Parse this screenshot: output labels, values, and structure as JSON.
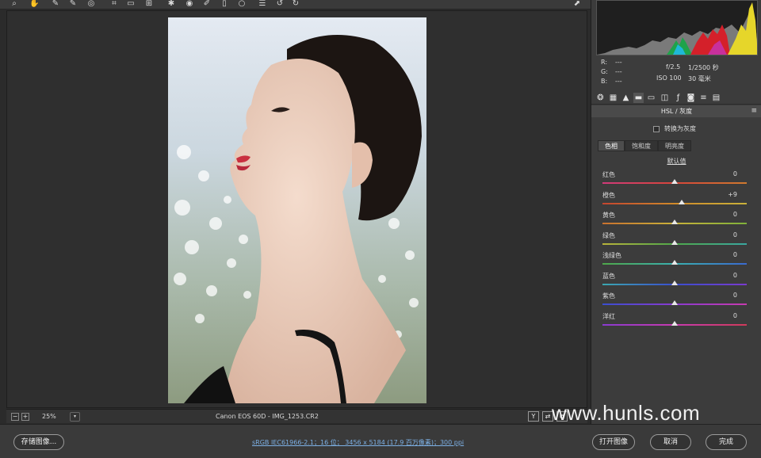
{
  "toolbar": {
    "tools": [
      "zoom-icon",
      "hand-icon",
      "white-balance-icon",
      "color-sampler-icon",
      "target-adjust-icon",
      "crop-icon",
      "straighten-icon",
      "transform-icon",
      "spot-removal-icon",
      "red-eye-icon",
      "adjustment-brush-icon",
      "graduated-filter-icon",
      "radial-filter-icon",
      "preferences-icon",
      "rotate-left-icon",
      "rotate-right-icon"
    ],
    "right_icon": "fullscreen-icon"
  },
  "readout": {
    "r_label": "R:",
    "r_value": "---",
    "g_label": "G:",
    "g_value": "---",
    "b_label": "B:",
    "b_value": "---",
    "aperture": "f/2.5",
    "shutter": "1/2500 秒",
    "iso": "ISO 100",
    "focal": "30 毫米"
  },
  "panel": {
    "section_title": "HSL / 灰度",
    "convert_gray": "转换为灰度",
    "subtabs": [
      {
        "label": "色相",
        "active": true
      },
      {
        "label": "饱和度",
        "active": false
      },
      {
        "label": "明亮度",
        "active": false
      }
    ],
    "defaults_link": "默认值",
    "sliders": [
      {
        "label": "红色",
        "value": "0",
        "pos": 0.5,
        "gradient": [
          "#d13a7a",
          "#d8463a",
          "#d07a2e"
        ]
      },
      {
        "label": "橙色",
        "value": "+9",
        "pos": 0.55,
        "gradient": [
          "#c4452e",
          "#d08a2a",
          "#c9b23a"
        ]
      },
      {
        "label": "黄色",
        "value": "0",
        "pos": 0.5,
        "gradient": [
          "#c9722e",
          "#c9b23a",
          "#7fb23a"
        ]
      },
      {
        "label": "绿色",
        "value": "0",
        "pos": 0.5,
        "gradient": [
          "#b9b43a",
          "#4fa84a",
          "#3aa8a0"
        ]
      },
      {
        "label": "浅绿色",
        "value": "0",
        "pos": 0.5,
        "gradient": [
          "#4fa84a",
          "#3ab0b0",
          "#3a6ad0"
        ]
      },
      {
        "label": "蓝色",
        "value": "0",
        "pos": 0.5,
        "gradient": [
          "#3aa8b0",
          "#3a4ed0",
          "#7a3ad0"
        ]
      },
      {
        "label": "紫色",
        "value": "0",
        "pos": 0.5,
        "gradient": [
          "#3a4ed0",
          "#8a3ad0",
          "#c83ab0"
        ]
      },
      {
        "label": "洋红",
        "value": "0",
        "pos": 0.5,
        "gradient": [
          "#8a3ad0",
          "#c83ab0",
          "#d03a5a"
        ]
      }
    ]
  },
  "status": {
    "zoom": "25%",
    "file_info": "Canon EOS 60D -  IMG_1253.CR2"
  },
  "bottom": {
    "save_label": "存储图像...",
    "workflow_text": "sRGB IEC61966-2.1；16 位；  3456 x 5184 (17.9 百万像素)；300 ppi",
    "open_label": "打开图像",
    "cancel_label": "取消",
    "done_label": "完成"
  },
  "watermark": "www.hunls.com"
}
